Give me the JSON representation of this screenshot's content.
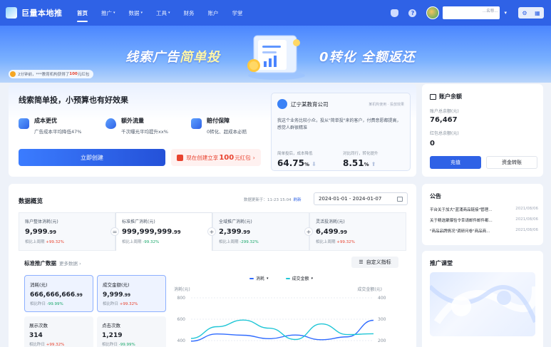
{
  "app": {
    "name": "巨量本地推"
  },
  "nav": [
    {
      "label": "首页",
      "has_menu": false,
      "active": true
    },
    {
      "label": "推广",
      "has_menu": true
    },
    {
      "label": "数据",
      "has_menu": true
    },
    {
      "label": "工具",
      "has_menu": true
    },
    {
      "label": "财务",
      "has_menu": false
    },
    {
      "label": "账户",
      "has_menu": false
    },
    {
      "label": "学堂",
      "has_menu": false
    }
  ],
  "header": {
    "help_glyph": "?",
    "user_name": "...名称...",
    "caret": "▾",
    "settings_glyph": "⚙",
    "grid_glyph": "▦"
  },
  "banner": {
    "left_text_a": "线索广告",
    "left_text_b": "简单投",
    "right_text": "0转化 全额返还",
    "ticker_prefix": "2分钟前，",
    "ticker_middle": "***教育机构获得了",
    "ticker_amount": "100",
    "ticker_suffix": "元红包"
  },
  "hero": {
    "title": "线索简单投，小预算也有好效果",
    "features": [
      {
        "name": "成本更优",
        "desc": "广告成本平均降低47%"
      },
      {
        "name": "额外流量",
        "desc": "千次曝光平均提升xx%"
      },
      {
        "name": "赔付保障",
        "desc": "0转化、超成本必赔"
      }
    ],
    "create_button": "立即创建",
    "redbag_prefix": "现在创建立享",
    "redbag_amount": "100",
    "redbag_suffix": "元红包",
    "redbag_arrow": "›",
    "case": {
      "company": "辽宁某教育公司",
      "tag": "某机构使用 · 投放效果",
      "desc": "我这个业务比较小众，投从\"简单投\"来的客户，付费意愿都提高，感觉人群很精准",
      "stats": [
        {
          "label": "简单投后，成本降低",
          "value": "64.75",
          "unit": "%",
          "arrow": "⬇"
        },
        {
          "label": "对比同行，转化提升",
          "value": "8.51",
          "unit": "%",
          "arrow": "⬆"
        }
      ]
    }
  },
  "account": {
    "title": "账户余额",
    "balance_label": "账户总余额(元)",
    "balance": "76,467",
    "redbag_label": "红包总余额(元)",
    "redbag": "0",
    "recharge_button": "充值",
    "transfer_button": "资金转账"
  },
  "overview": {
    "title": "数据概览",
    "update_text": "数据更新于：11-23 15:04",
    "refresh": "刷新",
    "date_range": "2024-01-01 - 2024-01-07",
    "metrics": [
      {
        "label": "账户整体消耗(元)",
        "value": "9,999",
        "decimals": ".99",
        "change_label": "相比上周期",
        "change": "+99.32%",
        "trend": "up",
        "op": "="
      },
      {
        "label": "标准推广消耗(元)",
        "value": "999,999,999",
        "decimals": ".99",
        "change_label": "相比上周期",
        "change": "-99.32%",
        "trend": "down",
        "op": "+"
      },
      {
        "label": "全域推广消耗(元)",
        "value": "2,399",
        "decimals": ".99",
        "change_label": "相比上周期",
        "change": "-299.32%",
        "trend": "down",
        "op": "+"
      },
      {
        "label": "灵活投消耗(元)",
        "value": "6,499",
        "decimals": ".99",
        "change_label": "相比上周期",
        "change": "+99.32%",
        "trend": "up",
        "op": ""
      }
    ],
    "std": {
      "title": "标准推广数据",
      "more": "更多数据 ›",
      "custom_button": "自定义指标",
      "cards": [
        {
          "label": "消耗(元)",
          "value": "666,666,666",
          "decimals": ".99",
          "change_label": "相比昨日",
          "change": "-99.99%",
          "trend": "down"
        },
        {
          "label": "成交金额(元)",
          "value": "9,999",
          "decimals": ".99",
          "change_label": "相比昨日",
          "change": "+99.32%",
          "trend": "up"
        },
        {
          "label": "展示次数",
          "value": "314",
          "decimals": "",
          "change_label": "相比昨日",
          "change": "+99.32%",
          "trend": "up"
        },
        {
          "label": "点击次数",
          "value": "1,219",
          "decimals": "",
          "change_label": "相比昨日",
          "change": "-99.99%",
          "trend": "down"
        }
      ]
    }
  },
  "chart_data": {
    "type": "line",
    "ylabel_left": "消耗(元)",
    "ylabel_right": "成交金额(元)",
    "left_ticks": [
      "800",
      "600",
      "400"
    ],
    "right_ticks": [
      "400",
      "300",
      "200"
    ],
    "series": [
      {
        "name": "消耗",
        "color": "#2f6bff",
        "values": [
          395,
          462,
          450,
          418,
          452,
          408,
          435,
          590
        ]
      },
      {
        "name": "成交金额",
        "color": "#20c6d6",
        "values": [
          210,
          265,
          296,
          258,
          205,
          278,
          228,
          232
        ]
      }
    ]
  },
  "notices": {
    "title": "公告",
    "items": [
      {
        "text": "平台关于加大\"蓝涌商品链接\"管理...",
        "date": "2021/08/06"
      },
      {
        "text": "关于精选聚爆恰令幸请邮件邮件都...",
        "date": "2021/08/06"
      },
      {
        "text": "\"商品品牌情况\"调研问卷\"商品商...",
        "date": "2021/08/06"
      }
    ]
  },
  "course": {
    "title": "推广课堂"
  }
}
